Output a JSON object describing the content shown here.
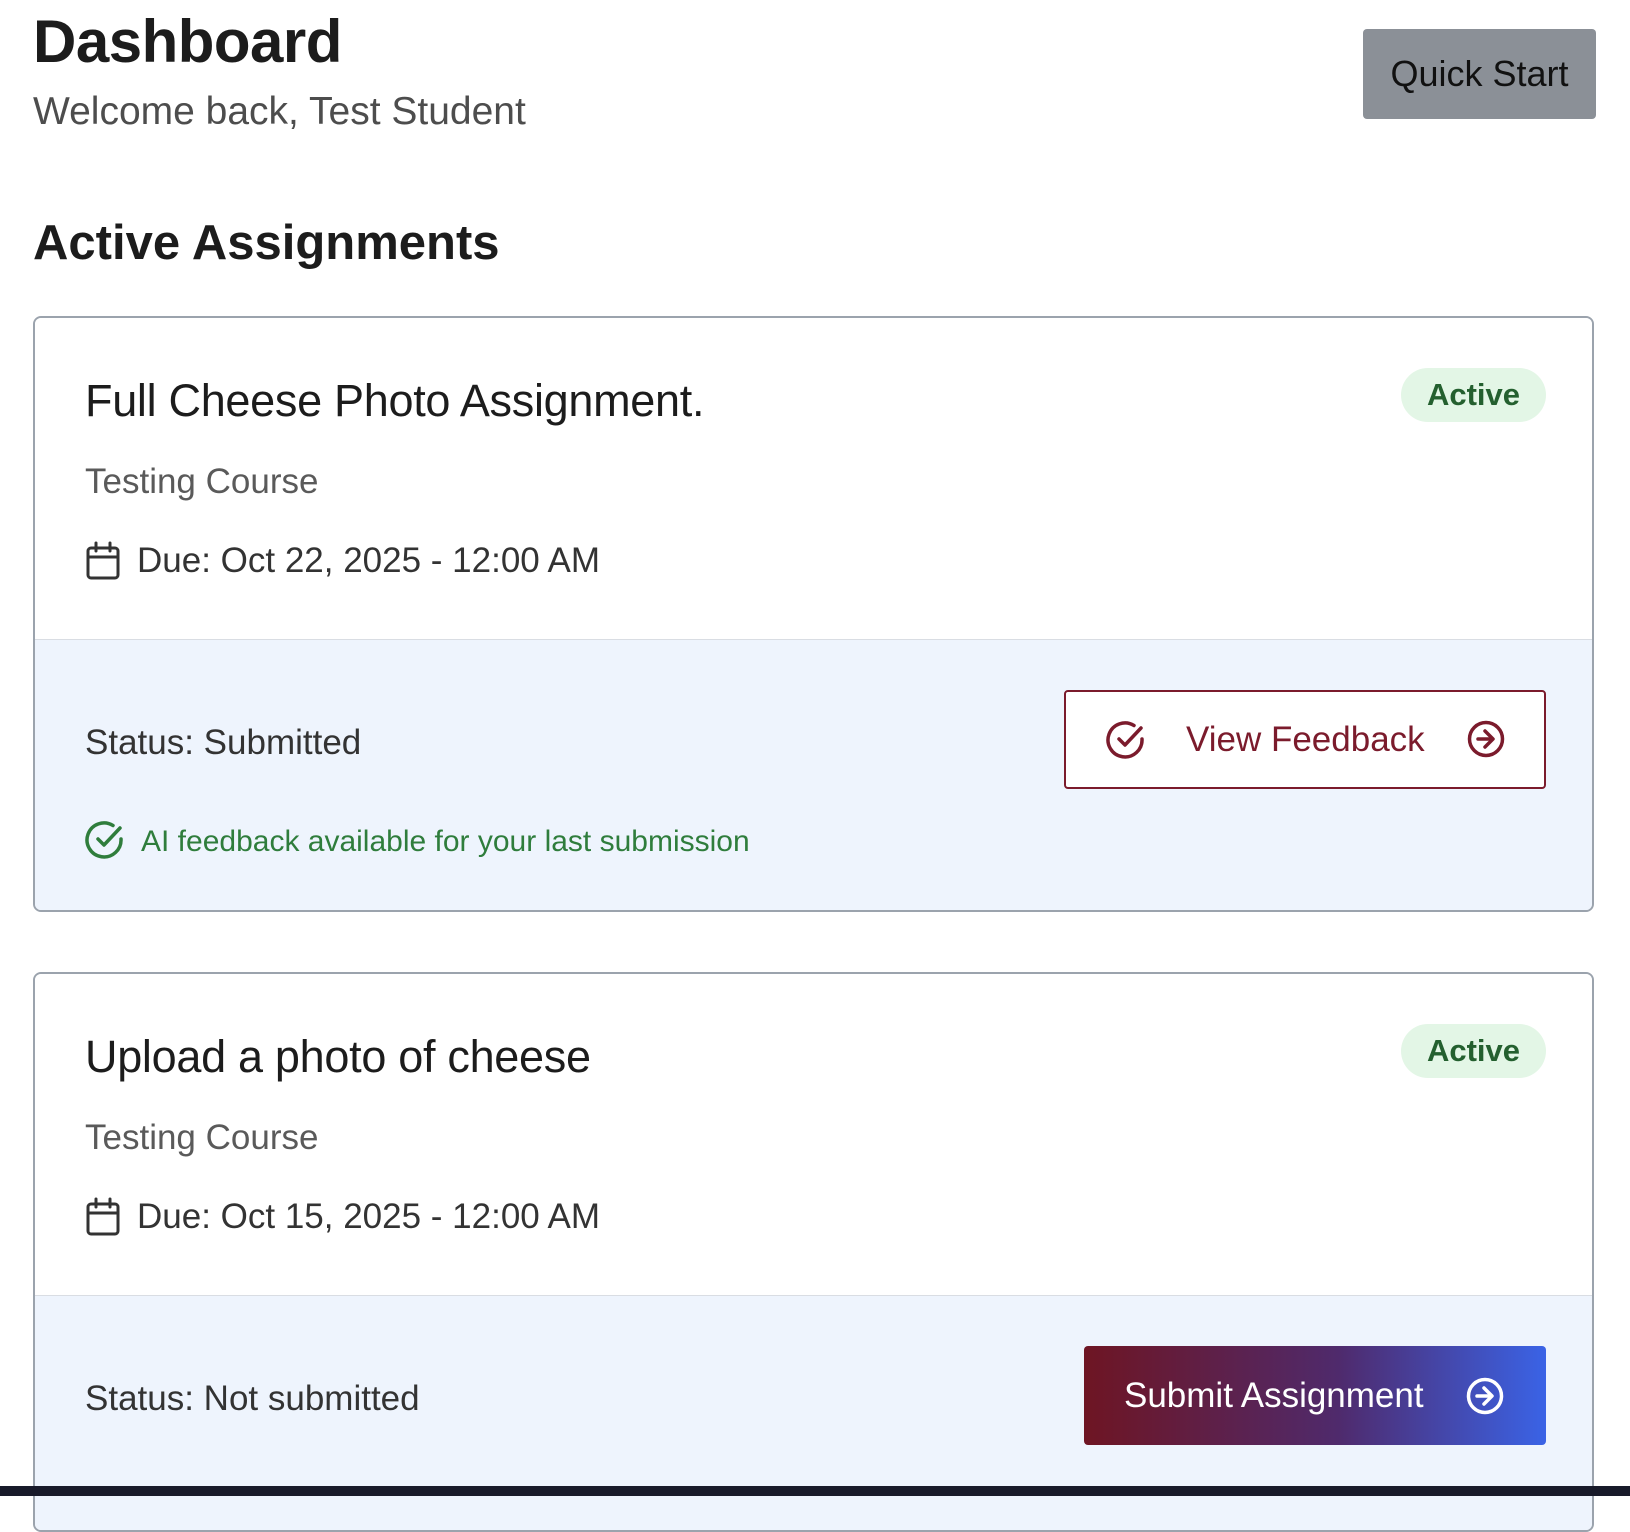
{
  "header": {
    "title": "Dashboard",
    "subtitle": "Welcome back, Test Student",
    "quick_start_label": "Quick Start"
  },
  "section": {
    "title": "Active Assignments"
  },
  "assignments": [
    {
      "title": "Full Cheese Photo Assignment.",
      "badge": "Active",
      "course": "Testing Course",
      "due": "Due: Oct 22, 2025 - 12:00 AM",
      "status": "Status: Submitted",
      "action_label": "View Feedback",
      "note": "AI feedback available for your last submission"
    },
    {
      "title": "Upload a photo of cheese",
      "badge": "Active",
      "course": "Testing Course",
      "due": "Due: Oct 15, 2025 - 12:00 AM",
      "status": "Status: Not submitted",
      "action_label": "Submit Assignment"
    }
  ],
  "colors": {
    "brand_maroon": "#7b1b2c",
    "badge_bg": "#e3f6e6",
    "badge_text": "#24602f",
    "card_footer_bg": "#eef4fd",
    "success_green": "#2f7d3c",
    "quick_start_bg": "#8b9097",
    "submit_gradient_start": "#6e1523",
    "submit_gradient_end": "#3a63e6"
  },
  "icons": {
    "due": "calendar-icon",
    "feedback_left": "check-circle-icon",
    "feedback_right": "arrow-circle-right-icon",
    "note": "check-circle-icon",
    "submit_right": "arrow-circle-right-icon"
  }
}
